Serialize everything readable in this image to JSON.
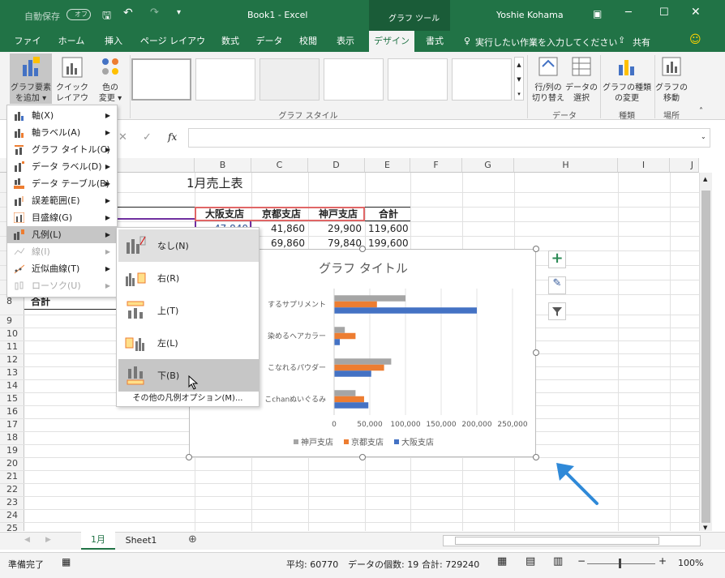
{
  "title_bar": {
    "autosave": "自動保存",
    "autosave_state": "オフ",
    "doc_title": "Book1 - Excel",
    "tools_context": "グラフ ツール",
    "user": "Yoshie Kohama"
  },
  "tabs": [
    "ファイル",
    "ホーム",
    "挿入",
    "ページ レイアウト",
    "数式",
    "データ",
    "校閲",
    "表示",
    "デザイン",
    "書式"
  ],
  "tell_me": "実行したい作業を入力してください",
  "share": "共有",
  "ribbon": {
    "add_element": [
      "グラフ要素",
      "を追加 ▾"
    ],
    "quick_layout": [
      "クイック",
      "レイアウト ▾"
    ],
    "change_colors": [
      "色の",
      "変更 ▾"
    ],
    "group_styles": "グラフ スタイル",
    "switch_rowcol": [
      "行/列の",
      "切り替え"
    ],
    "select_data": [
      "データの",
      "選択"
    ],
    "group_data": "データ",
    "change_type": [
      "グラフの種類",
      "の変更"
    ],
    "group_type": "種類",
    "move_chart": [
      "グラフの",
      "移動"
    ],
    "group_location": "場所"
  },
  "formula_bar": {
    "fx": "fx"
  },
  "columns": [
    "B",
    "C",
    "D",
    "E",
    "F",
    "G",
    "H",
    "I",
    "J"
  ],
  "rows": [
    "8",
    "9",
    "10",
    "11",
    "12",
    "13",
    "14",
    "15",
    "16",
    "17",
    "18",
    "19",
    "20",
    "21",
    "22",
    "23",
    "24",
    "25"
  ],
  "sheet": {
    "title": "1月売上表",
    "headers": [
      "大阪支店",
      "京都支店",
      "神戸支店",
      "合計"
    ],
    "row_a": [
      "47,840",
      "41,860",
      "29,900",
      "119,600"
    ],
    "row_b": [
      "",
      "69,860",
      "79,840",
      "199,600"
    ],
    "total_label": "合計"
  },
  "menu": [
    {
      "label": "軸(X)",
      "arrow": "▶",
      "disabled": false
    },
    {
      "label": "軸ラベル(A)",
      "arrow": "▶",
      "disabled": false
    },
    {
      "label": "グラフ タイトル(C)",
      "arrow": "▶",
      "disabled": false
    },
    {
      "label": "データ ラベル(D)",
      "arrow": "▶",
      "disabled": false
    },
    {
      "label": "データ テーブル(B)",
      "arrow": "▶",
      "disabled": false
    },
    {
      "label": "誤差範囲(E)",
      "arrow": "▶",
      "disabled": false
    },
    {
      "label": "目盛線(G)",
      "arrow": "▶",
      "disabled": false
    },
    {
      "label": "凡例(L)",
      "arrow": "▶",
      "disabled": false
    },
    {
      "label": "線(I)",
      "arrow": "▶",
      "disabled": true
    },
    {
      "label": "近似曲線(T)",
      "arrow": "▶",
      "disabled": false
    },
    {
      "label": "ローソク(U)",
      "arrow": "▶",
      "disabled": true
    }
  ],
  "submenu": {
    "items": [
      "なし(N)",
      "右(R)",
      "上(T)",
      "左(L)",
      "下(B)"
    ],
    "more": "その他の凡例オプション(M)..."
  },
  "chart_data": {
    "type": "bar",
    "title": "グラフ タイトル",
    "categories": [
      "するサプリメント",
      "染めるヘアカラー",
      "こなれるパウダー",
      "こchanぬいぐるみ"
    ],
    "series": [
      {
        "name": "神戸支店",
        "color": "#a5a5a5",
        "values": [
          100000,
          15000,
          80000,
          30000
        ]
      },
      {
        "name": "京都支店",
        "color": "#ed7d31",
        "values": [
          60000,
          30000,
          70000,
          42000
        ]
      },
      {
        "name": "大阪支店",
        "color": "#4472c4",
        "values": [
          200000,
          8000,
          52000,
          48000
        ]
      }
    ],
    "xlim": [
      0,
      250000
    ],
    "xticks": [
      "0",
      "50,000",
      "100,000",
      "150,000",
      "200,000",
      "250,000"
    ],
    "legend_position": "bottom"
  },
  "sheet_tabs": [
    "1月",
    "Sheet1"
  ],
  "status": {
    "ready": "準備完了",
    "average": "平均: 60770",
    "count": "データの個数: 19",
    "sum": "合計: 729240",
    "zoom": "100%"
  }
}
